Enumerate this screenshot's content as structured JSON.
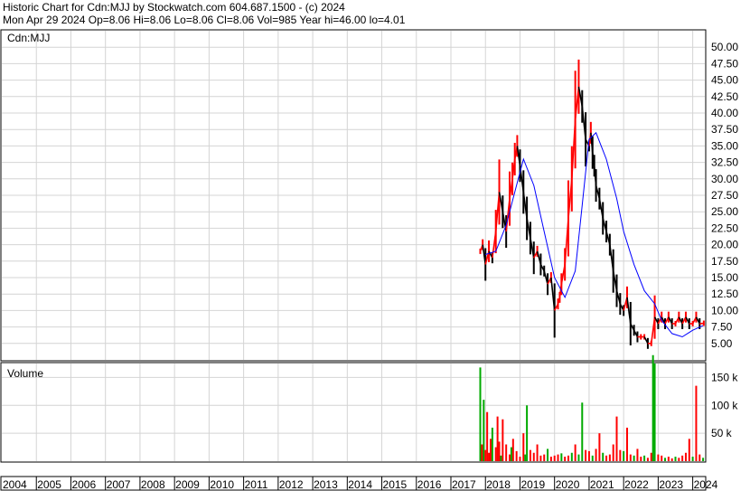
{
  "header": {
    "line1": "Historic Chart for Cdn:MJJ by Stockwatch.com 604.687.1500 - (c) 2024",
    "line2": "Mon Apr 29 2024  Op=8.06  Hi=8.06  Lo=8.06  Cl=8.06  Vol=985  Year hi=46.00  lo=4.01"
  },
  "chart_data": [
    {
      "type": "line",
      "title": "Cdn:MJJ",
      "y_ticks": [
        "50.00",
        "47.50",
        "45.00",
        "42.50",
        "40.00",
        "37.50",
        "35.00",
        "32.50",
        "30.00",
        "27.50",
        "25.00",
        "22.50",
        "20.00",
        "17.50",
        "15.00",
        "12.50",
        "10.00",
        "7.50",
        "5.00"
      ],
      "ylim": [
        2.5,
        52.5
      ],
      "grid": true,
      "colors": {
        "price_up": "#ff0000",
        "price_down": "#000000",
        "moving_average": "#0000ff"
      },
      "series": [
        {
          "kind": "price",
          "x": [
            2017.85,
            2017.92,
            2018.0,
            2018.1,
            2018.2,
            2018.3,
            2018.4,
            2018.5,
            2018.6,
            2018.7,
            2018.78,
            2018.85,
            2018.92,
            2019.0,
            2019.1,
            2019.2,
            2019.3,
            2019.4,
            2019.5,
            2019.6,
            2019.7,
            2019.8,
            2019.9,
            2020.0,
            2020.1,
            2020.15,
            2020.2,
            2020.3,
            2020.4,
            2020.5,
            2020.6,
            2020.7,
            2020.8,
            2020.9,
            2021.0,
            2021.05,
            2021.1,
            2021.15,
            2021.2,
            2021.3,
            2021.4,
            2021.5,
            2021.6,
            2021.7,
            2021.8,
            2021.9,
            2022.0,
            2022.1,
            2022.2,
            2022.3,
            2022.4,
            2022.5,
            2022.6,
            2022.7,
            2022.8,
            2022.9,
            2023.0,
            2023.1,
            2023.2,
            2023.3,
            2023.4,
            2023.5,
            2023.6,
            2023.7,
            2023.8,
            2023.9,
            2024.0,
            2024.1,
            2024.2,
            2024.32
          ],
          "values": [
            19,
            20,
            17,
            19,
            18,
            22,
            28,
            25,
            22,
            27,
            30,
            33,
            35,
            32,
            28,
            24,
            21,
            18,
            19,
            17,
            16,
            14,
            15,
            10,
            11,
            12,
            14,
            17,
            24,
            30,
            39,
            44,
            41,
            36,
            35,
            37,
            34,
            32,
            29,
            27,
            24,
            22,
            20,
            16,
            13,
            11,
            10,
            12,
            8,
            7,
            6,
            6,
            6,
            5,
            5,
            9,
            8,
            9,
            8,
            9,
            8,
            8,
            9,
            8,
            9,
            8,
            8,
            9,
            8,
            8.06
          ]
        },
        {
          "kind": "moving_average",
          "x": [
            2018.0,
            2018.3,
            2018.6,
            2018.9,
            2019.1,
            2019.4,
            2019.7,
            2020.0,
            2020.3,
            2020.6,
            2020.8,
            2021.0,
            2021.2,
            2021.5,
            2021.8,
            2022.0,
            2022.3,
            2022.6,
            2022.9,
            2023.1,
            2023.4,
            2023.7,
            2024.0,
            2024.3
          ],
          "values": [
            18.5,
            19,
            23,
            29,
            33,
            29,
            22,
            15,
            12,
            16,
            26,
            36,
            37,
            33,
            27,
            22,
            17,
            13,
            11,
            8.5,
            6.5,
            6,
            7,
            7.7
          ]
        }
      ]
    },
    {
      "type": "bar",
      "title": "Volume",
      "y_ticks": [
        "150 k",
        "100 k",
        "50 k"
      ],
      "ylim": [
        0,
        175
      ],
      "x_ticks": [
        "2004",
        "2005",
        "2006",
        "2007",
        "2008",
        "2009",
        "2010",
        "2011",
        "2012",
        "2013",
        "2014",
        "2015",
        "2016",
        "2017",
        "2018",
        "2019",
        "2020",
        "2021",
        "2022",
        "2023",
        "2024"
      ],
      "xlim": [
        2004,
        2024.35
      ],
      "colors": {
        "up": "#00aa00",
        "down": "#ff0000"
      },
      "x": [
        2017.85,
        2017.9,
        2017.95,
        2018.0,
        2018.05,
        2018.1,
        2018.15,
        2018.2,
        2018.3,
        2018.35,
        2018.4,
        2018.45,
        2018.5,
        2018.6,
        2018.7,
        2018.75,
        2018.8,
        2018.9,
        2019.0,
        2019.1,
        2019.15,
        2019.2,
        2019.3,
        2019.4,
        2019.5,
        2019.6,
        2019.7,
        2019.8,
        2019.9,
        2020.0,
        2020.1,
        2020.2,
        2020.3,
        2020.4,
        2020.5,
        2020.6,
        2020.7,
        2020.8,
        2020.9,
        2021.0,
        2021.1,
        2021.2,
        2021.3,
        2021.4,
        2021.5,
        2021.6,
        2021.7,
        2021.8,
        2021.9,
        2022.0,
        2022.1,
        2022.2,
        2022.3,
        2022.4,
        2022.5,
        2022.6,
        2022.7,
        2022.8,
        2022.85,
        2022.9,
        2023.0,
        2023.1,
        2023.2,
        2023.3,
        2023.4,
        2023.5,
        2023.6,
        2023.7,
        2023.8,
        2023.9,
        2024.0,
        2024.1,
        2024.2,
        2024.3
      ],
      "values": [
        168,
        30,
        110,
        20,
        88,
        15,
        40,
        60,
        25,
        80,
        35,
        10,
        75,
        30,
        12,
        25,
        40,
        18,
        8,
        50,
        12,
        100,
        20,
        15,
        30,
        10,
        12,
        22,
        8,
        10,
        12,
        14,
        8,
        10,
        15,
        30,
        12,
        105,
        20,
        18,
        10,
        22,
        50,
        15,
        10,
        12,
        30,
        80,
        20,
        18,
        60,
        12,
        10,
        22,
        8,
        10,
        6,
        15,
        190,
        175,
        12,
        10,
        6,
        8,
        5,
        8,
        6,
        10,
        15,
        40,
        8,
        135,
        12,
        6
      ],
      "up": [
        true,
        false,
        true,
        false,
        false,
        false,
        false,
        true,
        false,
        false,
        false,
        true,
        false,
        false,
        false,
        true,
        false,
        false,
        false,
        false,
        true,
        true,
        false,
        false,
        false,
        false,
        false,
        true,
        false,
        false,
        false,
        true,
        false,
        false,
        true,
        false,
        true,
        true,
        false,
        false,
        true,
        false,
        false,
        true,
        false,
        false,
        false,
        false,
        false,
        true,
        false,
        false,
        true,
        false,
        false,
        true,
        false,
        false,
        true,
        true,
        false,
        false,
        true,
        false,
        false,
        true,
        false,
        false,
        false,
        false,
        true,
        false,
        false,
        true
      ]
    }
  ]
}
